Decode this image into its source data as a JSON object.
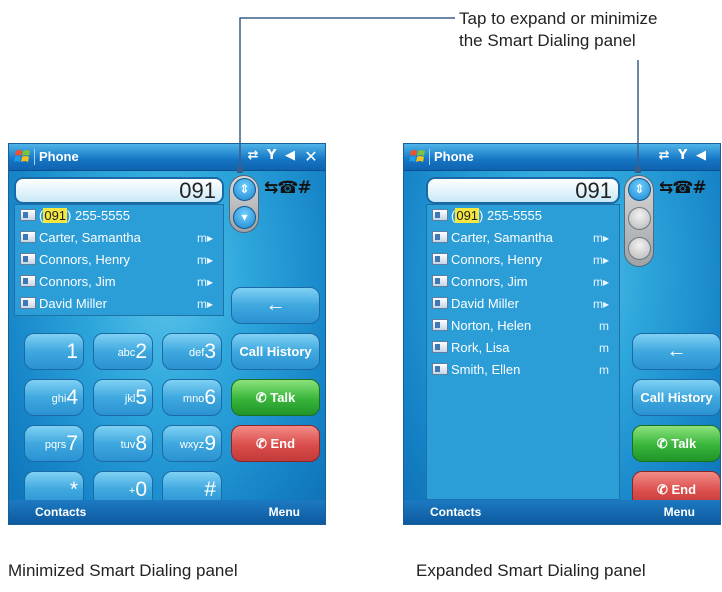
{
  "callout": {
    "line1": "Tap to expand or minimize",
    "line2": "the Smart Dialing panel"
  },
  "phone_min": {
    "title": "Phone",
    "number": "091",
    "suggestions": [
      {
        "prefix": "(",
        "highlight": "091",
        "rest": ") 255-5555",
        "type": "call-log"
      },
      {
        "name": "Carter, Samantha",
        "label": "m▸"
      },
      {
        "name": "Connors, Henry",
        "label": "m▸"
      },
      {
        "name": "Connors, Jim",
        "label": "m▸"
      },
      {
        "name": "David Miller",
        "label": "m▸"
      }
    ],
    "keypad": [
      {
        "sub": "",
        "main": "1"
      },
      {
        "sub": "abc",
        "main": "2"
      },
      {
        "sub": "def",
        "main": "3"
      },
      {
        "sub": "ghi",
        "main": "4"
      },
      {
        "sub": "jkl",
        "main": "5"
      },
      {
        "sub": "mno",
        "main": "6"
      },
      {
        "sub": "pqrs",
        "main": "7"
      },
      {
        "sub": "tuv",
        "main": "8"
      },
      {
        "sub": "wxyz",
        "main": "9"
      },
      {
        "sub": "",
        "main": "*"
      },
      {
        "sub": "+",
        "main": "0"
      },
      {
        "sub": "",
        "main": "#"
      }
    ],
    "backspace": "←",
    "call_history": "Call History",
    "talk": "Talk",
    "end": "End",
    "left_soft": "Contacts",
    "right_soft": "Menu",
    "caption": "Minimized Smart Dialing panel"
  },
  "phone_exp": {
    "title": "Phone",
    "number": "091",
    "suggestions": [
      {
        "prefix": "(",
        "highlight": "091",
        "rest": ") 255-5555",
        "type": "call-log"
      },
      {
        "name": "Carter, Samantha",
        "label": "m▸"
      },
      {
        "name": "Connors, Henry",
        "label": "m▸"
      },
      {
        "name": "Connors, Jim",
        "label": "m▸"
      },
      {
        "name": "David Miller",
        "label": "m▸"
      },
      {
        "name": "Norton, Helen",
        "label": "m"
      },
      {
        "name": "Rork, Lisa",
        "label": "m"
      },
      {
        "name": "Smith, Ellen",
        "label": "m"
      }
    ],
    "backspace": "←",
    "call_history": "Call History",
    "talk": "Talk",
    "end": "End",
    "left_soft": "Contacts",
    "right_soft": "Menu",
    "caption": "Expanded Smart Dialing panel"
  },
  "icons": {
    "status": "signal-volume-icons",
    "close": "close-icon",
    "colors": {
      "accent": "#2ea7dc",
      "talk": "#38b53a",
      "end": "#da4d4b",
      "highlight": "#f5e640"
    }
  }
}
